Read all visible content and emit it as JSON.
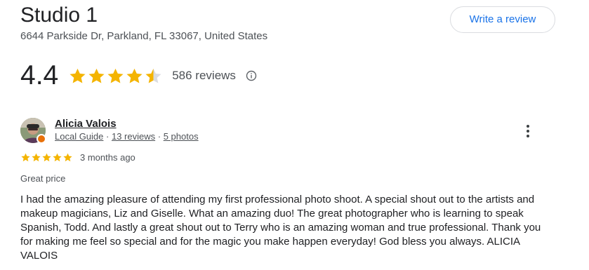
{
  "place": {
    "title": "Studio 1",
    "address": "6644 Parkside Dr, Parkland, FL 33067, United States"
  },
  "actions": {
    "write_review_label": "Write a review"
  },
  "summary": {
    "rating": "4.4",
    "reviews_count": "586 reviews",
    "star_color": "#f4b400",
    "star_empty_color": "#dadce0"
  },
  "review": {
    "reviewer_name": "Alicia Valois",
    "local_guide_label": "Local Guide",
    "reviews_link": "13 reviews",
    "photos_link": "5 photos",
    "meta_separator": "·",
    "rating": 5,
    "date": "3 months ago",
    "subject": "Great price",
    "body": "I had the amazing pleasure of attending my first professional photo shoot. A special shout out to the artists and makeup magicians, Liz and Giselle. What an amazing duo! The great photographer who is learning to speak Spanish, Todd. And lastly a great shout out to Terry who is an amazing woman and true professional. Thank you for making me feel so special and for the magic you make happen everyday! God bless you always. ALICIA VALOIS"
  },
  "colors": {
    "accent_blue": "#1a73e8",
    "badge_orange": "#e8710a"
  },
  "icons": {
    "info": "info-icon",
    "more": "more-vert-icon",
    "star": "star-icon",
    "local_guide_badge": "local-guide-badge-icon"
  }
}
